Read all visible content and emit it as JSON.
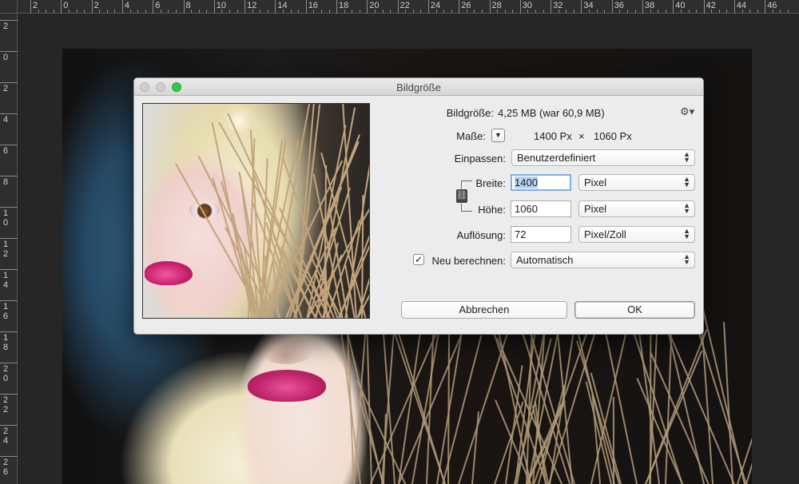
{
  "ruler": {
    "top_labels": [
      "2",
      "0",
      "2",
      "4",
      "6",
      "8",
      "10",
      "12",
      "14",
      "16",
      "18",
      "20",
      "22",
      "24",
      "26",
      "28",
      "30",
      "32",
      "34",
      "36",
      "38",
      "40",
      "42",
      "44",
      "46"
    ],
    "left_labels": [
      "2",
      "0",
      "2",
      "4",
      "6",
      "8",
      "1\n0",
      "1\n2",
      "1\n4",
      "1\n6",
      "1\n8",
      "2\n0",
      "2\n2",
      "2\n4",
      "2\n6"
    ]
  },
  "dialog": {
    "title": "Bildgröße",
    "bildgroesse_label": "Bildgröße:",
    "bildgroesse_value": "4,25 MB (war 60,9 MB)",
    "masse_label": "Maße:",
    "masse_width": "1400 Px",
    "masse_times": "×",
    "masse_height": "1060 Px",
    "einpassen_label": "Einpassen:",
    "einpassen_value": "Benutzerdefiniert",
    "breite_label": "Breite:",
    "breite_value": "1400",
    "breite_unit": "Pixel",
    "hoehe_label": "Höhe:",
    "hoehe_value": "1060",
    "hoehe_unit": "Pixel",
    "aufloesung_label": "Auflösung:",
    "aufloesung_value": "72",
    "aufloesung_unit": "Pixel/Zoll",
    "neu_berechnen_label": "Neu berechnen:",
    "neu_berechnen_checked": "✓",
    "neu_berechnen_value": "Automatisch",
    "cancel_label": "Abbrechen",
    "ok_label": "OK",
    "gear_glyph": "⚙▾",
    "chain_glyph": "⛓",
    "popup_arrows": "▲▼",
    "mini_arrow_glyph": "▼"
  },
  "colors": {
    "accent_focus": "#7fb0e6",
    "window_green": "#33c748"
  }
}
